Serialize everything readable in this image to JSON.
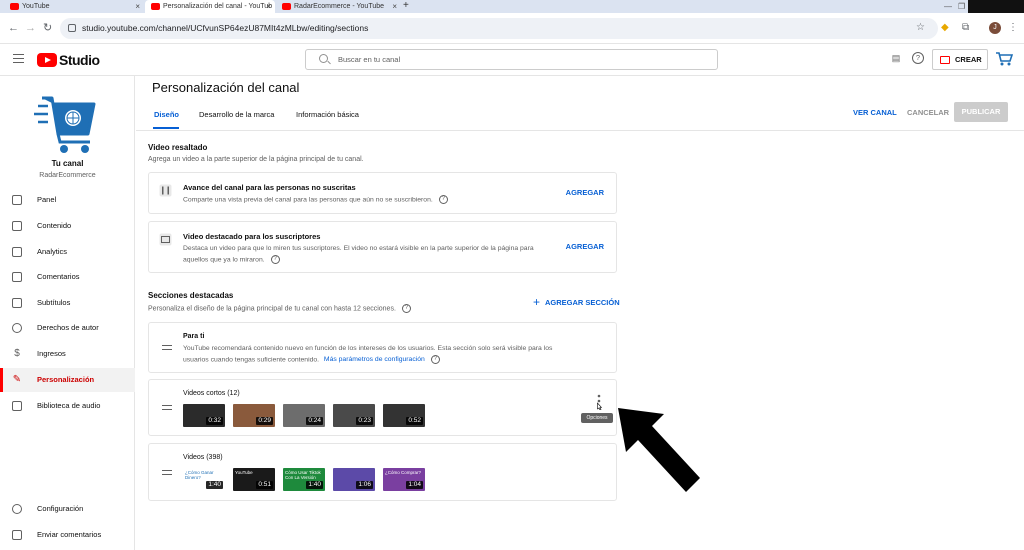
{
  "browser": {
    "tabs": [
      {
        "label": "YouTube",
        "active": false
      },
      {
        "label": "Personalización del canal - YouTub",
        "active": true
      },
      {
        "label": "RadarEcommerce - YouTube",
        "active": false
      }
    ],
    "new_tab": "+",
    "url": "studio.youtube.com/channel/UCfvunSP64ezU87MIt4zMLbw/editing/sections",
    "profile_initial": "J"
  },
  "header": {
    "logo_text": "Studio",
    "search_placeholder": "Buscar en tu canal",
    "create_label": "CREAR"
  },
  "sidebar": {
    "channel_title": "Tu canal",
    "channel_name": "RadarEcommerce",
    "items": [
      {
        "label": "Panel",
        "icon": "dashboard-icon"
      },
      {
        "label": "Contenido",
        "icon": "content-icon"
      },
      {
        "label": "Analytics",
        "icon": "analytics-icon"
      },
      {
        "label": "Comentarios",
        "icon": "comments-icon"
      },
      {
        "label": "Subtítulos",
        "icon": "subtitles-icon"
      },
      {
        "label": "Derechos de autor",
        "icon": "copyright-icon"
      },
      {
        "label": "Ingresos",
        "icon": "earn-icon"
      },
      {
        "label": "Personalización",
        "icon": "customization-icon",
        "active": true
      },
      {
        "label": "Biblioteca de audio",
        "icon": "audio-library-icon"
      }
    ],
    "bottom_items": [
      {
        "label": "Configuración",
        "icon": "settings-icon"
      },
      {
        "label": "Enviar comentarios",
        "icon": "feedback-icon"
      }
    ]
  },
  "main": {
    "title": "Personalización del canal",
    "tabs": [
      {
        "label": "Diseño",
        "active": true
      },
      {
        "label": "Desarrollo de la marca"
      },
      {
        "label": "Información básica"
      }
    ],
    "ver_canal": "VER CANAL",
    "cancelar": "CANCELAR",
    "publicar": "PUBLICAR",
    "featured_video": {
      "heading": "Video resaltado",
      "desc": "Agrega un video a la parte superior de la página principal de tu canal.",
      "cards": [
        {
          "title": "Avance del canal para las personas no suscritas",
          "desc": "Comparte una vista previa del canal para las personas que aún no se suscribieron.",
          "action": "AGREGAR"
        },
        {
          "title": "Video destacado para los suscriptores",
          "desc1": "Destaca un video para que lo miren tus suscriptores. El video no estará visible en la parte superior de la página para",
          "desc2": "aquellos que ya lo miraron.",
          "action": "AGREGAR"
        }
      ]
    },
    "featured_sections": {
      "heading": "Secciones destacadas",
      "desc": "Personaliza el diseño de la página principal de tu canal con hasta 12 secciones.",
      "add_label": "AGREGAR SECCIÓN",
      "para_ti": {
        "title": "Para ti",
        "desc1": "YouTube recomendará contenido nuevo en función de los intereses de los usuarios. Esta sección solo será visible para los",
        "desc2": "usuarios cuando tengas suficiente contenido.",
        "link": "Más parámetros de configuración"
      },
      "shorts": {
        "title": "Videos cortos (12)",
        "durations": [
          "0:32",
          "0:29",
          "0:24",
          "0:23",
          "0:52"
        ],
        "colors": [
          "#2b2b2b",
          "#8a5a3c",
          "#6d6d6d",
          "#4a4a4a",
          "#333333"
        ],
        "tooltip": "Opciones"
      },
      "videos": {
        "title": "Videos (398)",
        "durations": [
          "1:40",
          "0:51",
          "1:40",
          "1:06",
          "1:04"
        ],
        "colors": [
          "#ffffff",
          "#1a1a1a",
          "#1e8a3c",
          "#5c4aa8",
          "#7a3fa0"
        ],
        "thumb_texts": [
          "¿Cómo Ganar Dinero?",
          "YouTube",
          "Cómo Usar Tiktok Con La Versión",
          "",
          "¿Cómo Comprar?"
        ]
      }
    }
  }
}
